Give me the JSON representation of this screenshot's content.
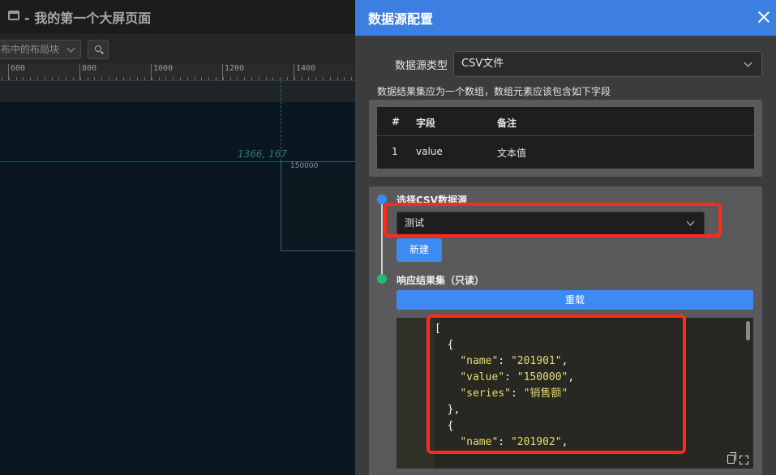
{
  "app": {
    "title": "- 我的第一个大屏页面"
  },
  "toolbar": {
    "layer_select": "布中的布局块"
  },
  "ruler": {
    "labels": [
      "600",
      "800",
      "1000",
      "1200",
      "1400"
    ]
  },
  "canvas": {
    "coord_label": "1366, 167",
    "widget_value": "150000"
  },
  "panel": {
    "title": "数据源配置",
    "type_label": "数据源类型",
    "type_value": "CSV文件",
    "hint": "数据结果集应为一个数组，数组元素应该包含如下字段",
    "fields_table": {
      "headers": [
        "#",
        "字段",
        "备注"
      ],
      "rows": [
        {
          "index": "1",
          "field": "value",
          "note": "文本值"
        }
      ]
    },
    "step1": {
      "label": "选择CSV数据源",
      "select_value": "测试",
      "new_button": "新建"
    },
    "step2": {
      "label": "响应结果集（只读）",
      "reload_button": "重载"
    },
    "code_lines": [
      "[",
      "  {",
      "    \"name\": \"201901\",",
      "    \"value\": \"150000\",",
      "    \"series\": \"销售额\"",
      "  },",
      "  {",
      "    \"name\": \"201902\","
    ]
  },
  "colors": {
    "accent": "#3d8bf0",
    "header": "#3d7fe0",
    "highlight": "#ff2a1a",
    "success": "#2bb673"
  }
}
